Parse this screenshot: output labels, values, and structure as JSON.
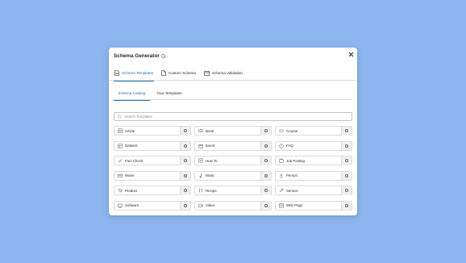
{
  "modal": {
    "title": "Schema Generator"
  },
  "main_tabs": [
    {
      "label": "Schema Templates",
      "icon": "document-icon",
      "active": true
    },
    {
      "label": "Custom Schema",
      "icon": "file-icon",
      "active": false
    },
    {
      "label": "Schema Validation",
      "icon": "window-icon",
      "active": false
    }
  ],
  "sub_tabs": [
    {
      "label": "Schema Catalog",
      "active": true
    },
    {
      "label": "Your Templates",
      "active": false
    }
  ],
  "search": {
    "placeholder": "Search Templates",
    "value": ""
  },
  "templates": [
    {
      "label": "Article",
      "icon": "article-icon"
    },
    {
      "label": "Book",
      "icon": "book-icon"
    },
    {
      "label": "Course",
      "icon": "course-icon"
    },
    {
      "label": "Dataset",
      "icon": "dataset-icon"
    },
    {
      "label": "Event",
      "icon": "event-icon"
    },
    {
      "label": "FAQ",
      "icon": "faq-icon"
    },
    {
      "label": "Fact Check",
      "icon": "fact-check-icon"
    },
    {
      "label": "How To",
      "icon": "how-to-icon"
    },
    {
      "label": "Job Posting",
      "icon": "job-posting-icon"
    },
    {
      "label": "Movie",
      "icon": "movie-icon"
    },
    {
      "label": "Music",
      "icon": "music-icon"
    },
    {
      "label": "Person",
      "icon": "person-icon"
    },
    {
      "label": "Product",
      "icon": "product-icon"
    },
    {
      "label": "Recipe",
      "icon": "recipe-icon"
    },
    {
      "label": "Service",
      "icon": "service-icon"
    },
    {
      "label": "Software",
      "icon": "software-icon"
    },
    {
      "label": "Video",
      "icon": "video-icon"
    },
    {
      "label": "Web Page",
      "icon": "web-page-icon"
    }
  ],
  "colors": {
    "background": "#8db6ef",
    "accent": "#2271b1",
    "text": "#1d2327",
    "border": "#dcdcde"
  }
}
